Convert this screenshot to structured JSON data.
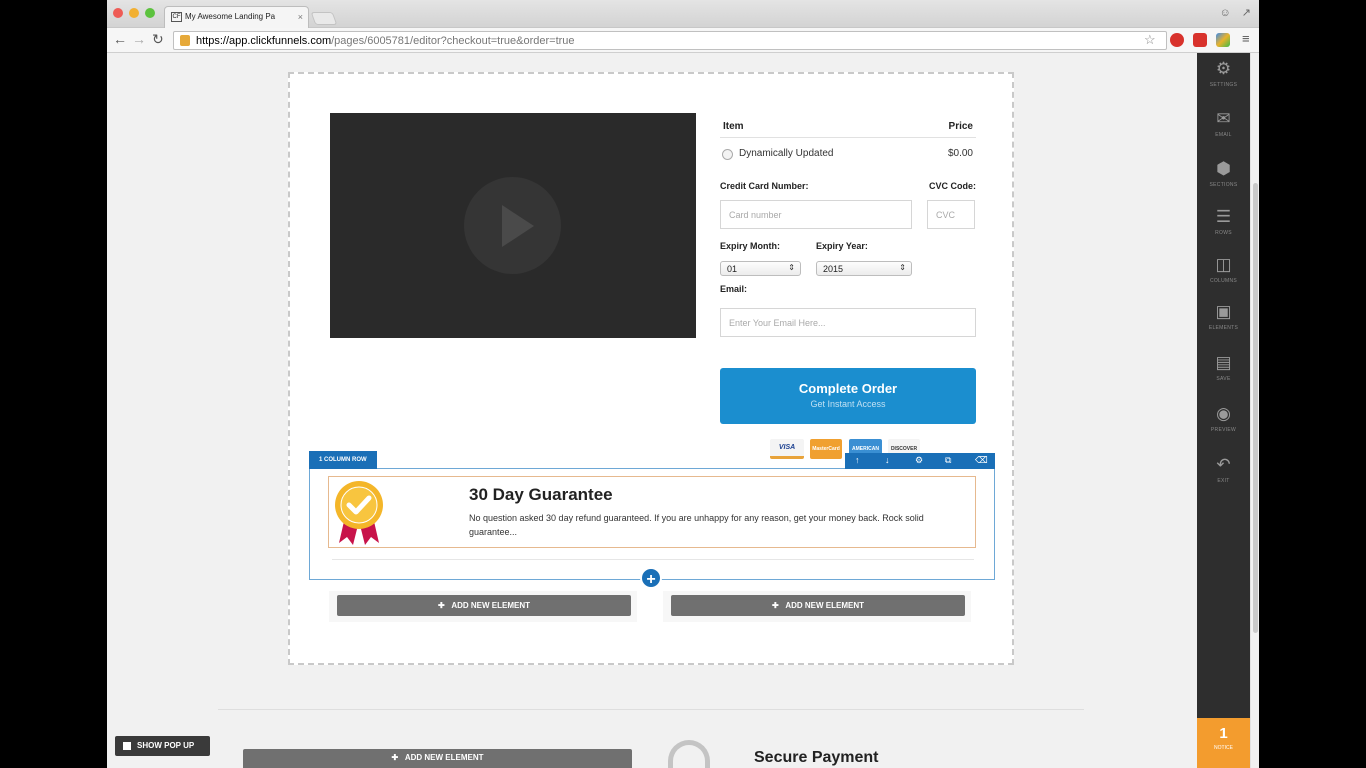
{
  "browser": {
    "tab_title": "My Awesome Landing Pa",
    "tab_favicon": "CF",
    "tab_close": "×",
    "url_host": "https://app.clickfunnels.com",
    "url_path": "/pages/6005781/editor?checkout=true&order=true",
    "traffic_colors": [
      "#ee5b55",
      "#f2b032",
      "#5cc23e"
    ]
  },
  "order_form": {
    "item_header": "Item",
    "price_header": "Price",
    "product_name": "Dynamically Updated",
    "product_price": "$0.00",
    "cc_label": "Credit Card Number:",
    "cvc_label": "CVC Code:",
    "card_placeholder": "Card number",
    "cvc_placeholder": "CVC",
    "expiry_month_label": "Expiry Month:",
    "expiry_year_label": "Expiry Year:",
    "expiry_month_value": "01",
    "expiry_year_value": "2015",
    "email_label": "Email:",
    "email_placeholder": "Enter Your Email Here...",
    "cta_main": "Complete Order",
    "cta_sub": "Get Instant Access",
    "card_logos": [
      "VISA",
      "MasterCard",
      "AMERICAN",
      "DISCOVER"
    ]
  },
  "row": {
    "tag": "1 COLUMN ROW",
    "guarantee_title": "30 Day Guarantee",
    "guarantee_text": "No question asked 30 day refund guaranteed. If you are unhappy for any reason, get your money back. Rock solid guarantee..."
  },
  "canvas": {
    "add_element_label": "ADD NEW ELEMENT",
    "show_popup_label": "SHOW POP UP",
    "secure_payment_title": "Secure Payment"
  },
  "sidebar": {
    "items": [
      {
        "label": "SETTINGS",
        "icon": "gear-icon"
      },
      {
        "label": "EMAIL",
        "icon": "envelope-icon"
      },
      {
        "label": "SECTIONS",
        "icon": "cube-icon"
      },
      {
        "label": "ROWS",
        "icon": "rows-icon"
      },
      {
        "label": "COLUMNS",
        "icon": "columns-icon"
      },
      {
        "label": "ELEMENTS",
        "icon": "puzzle-icon"
      },
      {
        "label": "SAVE",
        "icon": "floppy-icon"
      },
      {
        "label": "PREVIEW",
        "icon": "eye-icon"
      },
      {
        "label": "EXIT",
        "icon": "undo-icon"
      }
    ],
    "notice_count": "1",
    "notice_label": "NOTICE"
  },
  "colors": {
    "accent": "#1b8ecf",
    "row_blue": "#1a6fb7",
    "notice_orange": "#f39c2e",
    "sidebar_dark": "#2e2e2e"
  }
}
